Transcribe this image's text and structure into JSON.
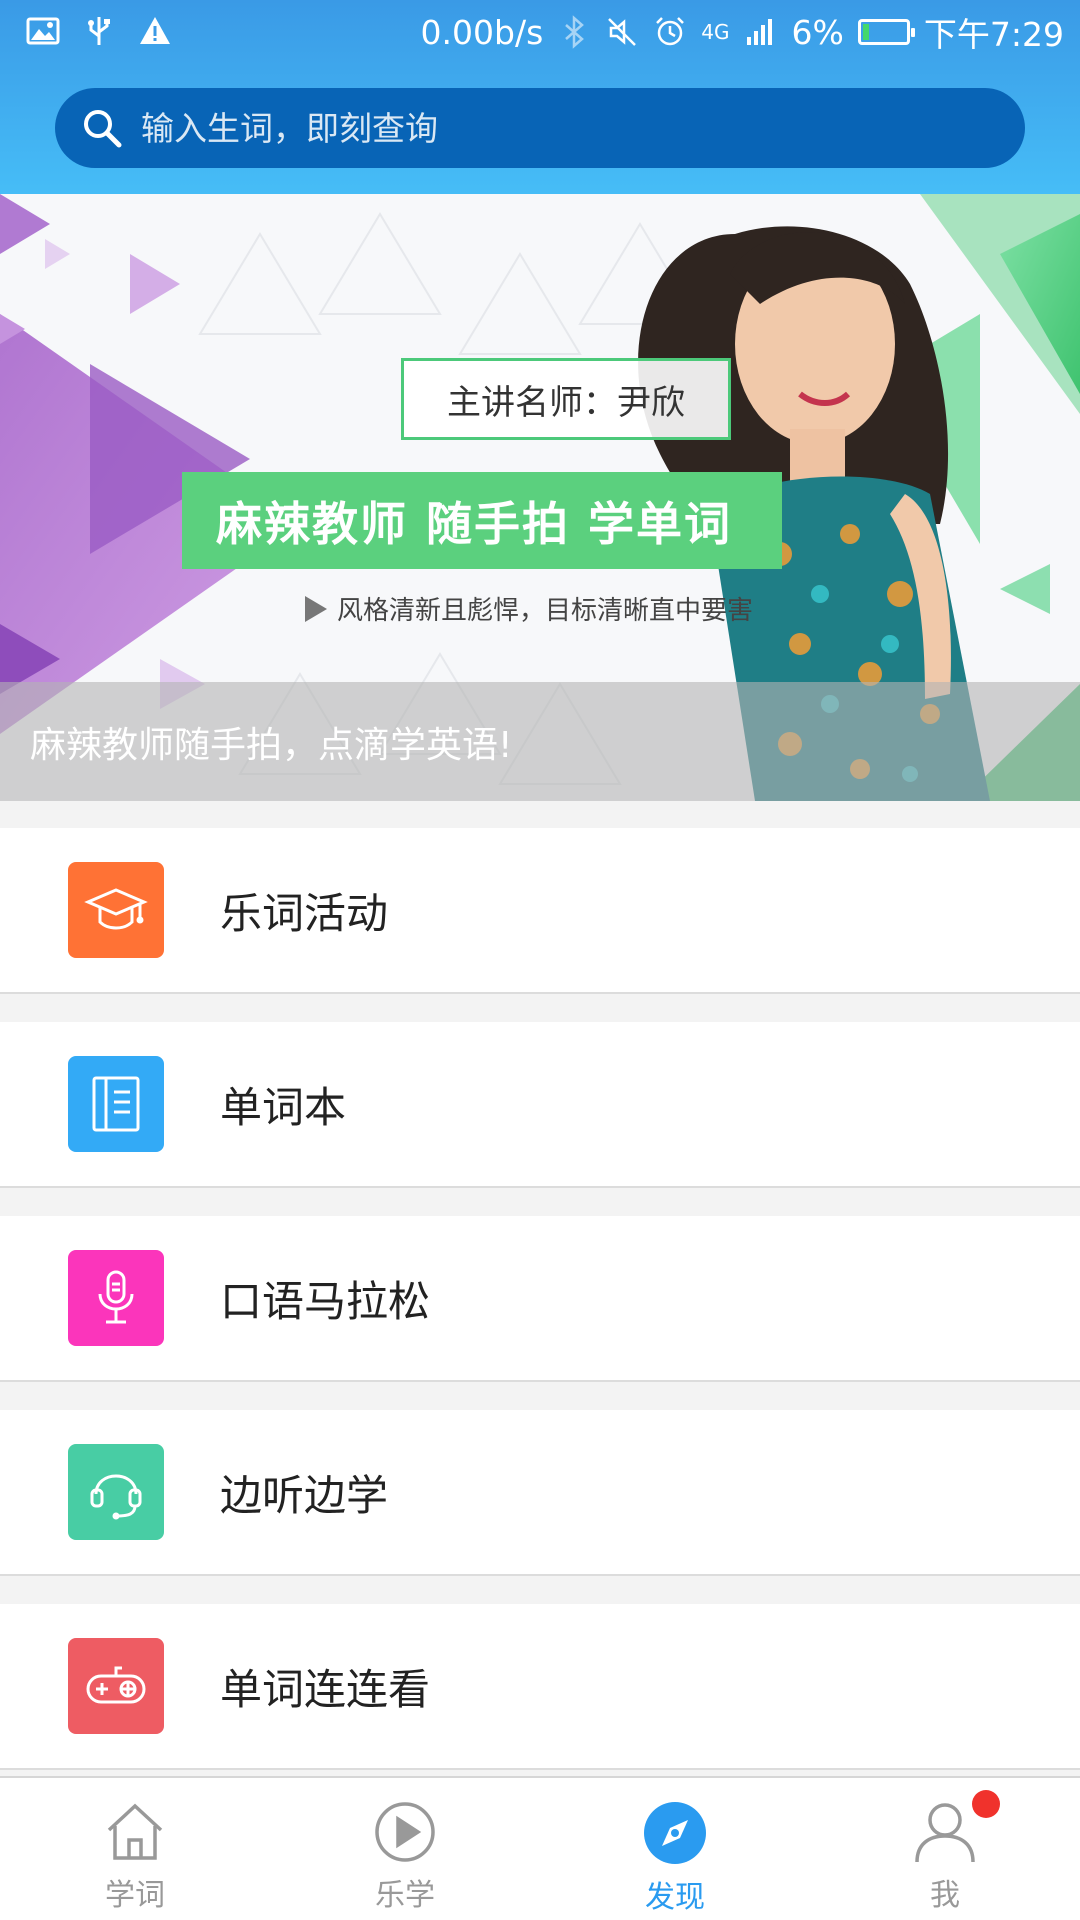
{
  "status_bar": {
    "speed": "0.00b/s",
    "network": "4G",
    "battery": "6%",
    "time": "下午7:29"
  },
  "search": {
    "placeholder": "输入生词，即刻查询"
  },
  "banner": {
    "teacher_label": "主讲名师：尹欣",
    "headline": "麻辣教师 随手拍  学单词",
    "tagline": "风格清新且彪悍，目标清晰直中要害",
    "caption": "麻辣教师随手拍，点滴学英语!"
  },
  "menu": {
    "items": [
      {
        "label": "乐词活动",
        "icon": "graduation-cap-icon",
        "color": "#ff7235"
      },
      {
        "label": "单词本",
        "icon": "notebook-icon",
        "color": "#33aaf6"
      },
      {
        "label": "口语马拉松",
        "icon": "microphone-icon",
        "color": "#fb35bb"
      },
      {
        "label": "边听边学",
        "icon": "headset-icon",
        "color": "#48cda4"
      },
      {
        "label": "单词连连看",
        "icon": "gamepad-icon",
        "color": "#ee5c63"
      }
    ]
  },
  "bottom_nav": {
    "items": [
      {
        "label": "学词",
        "icon": "home-icon"
      },
      {
        "label": "乐学",
        "icon": "play-icon"
      },
      {
        "label": "发现",
        "icon": "discover-icon",
        "active": true
      },
      {
        "label": "我",
        "icon": "user-icon"
      }
    ],
    "active_color": "#2a9bf0"
  }
}
